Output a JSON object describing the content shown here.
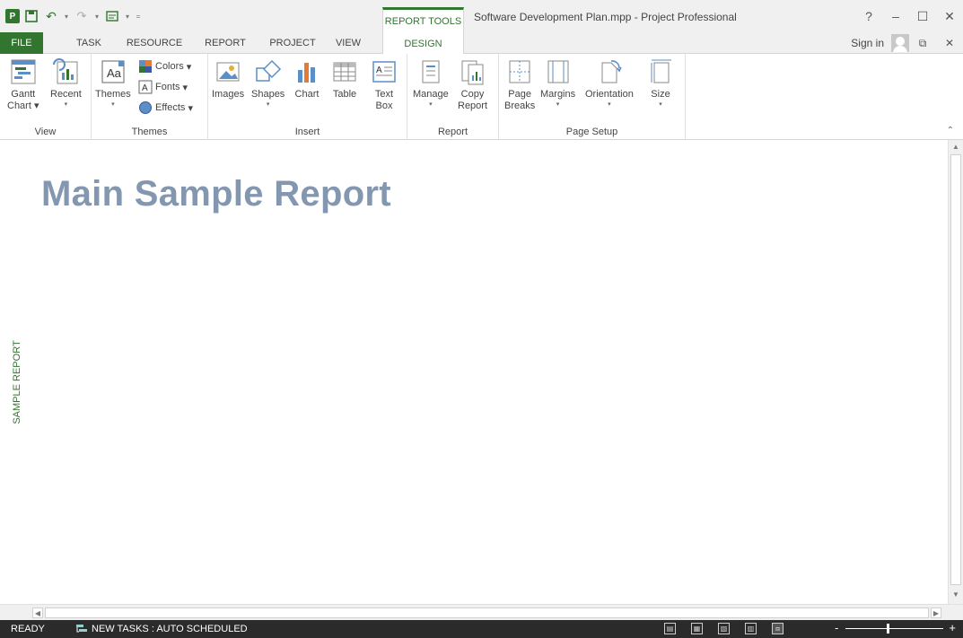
{
  "app": {
    "context_tab": "REPORT TOOLS",
    "title": "Software Development Plan.mpp - Project Professional",
    "help": "?"
  },
  "tabs": [
    {
      "label": "FILE"
    },
    {
      "label": "TASK"
    },
    {
      "label": "RESOURCE"
    },
    {
      "label": "REPORT"
    },
    {
      "label": "PROJECT"
    },
    {
      "label": "VIEW"
    },
    {
      "label": "DESIGN"
    }
  ],
  "account": {
    "signin": "Sign in"
  },
  "ribbon": {
    "view": {
      "label": "View",
      "gantt_l1": "Gantt",
      "gantt_l2": "Chart",
      "recent": "Recent"
    },
    "themes": {
      "label": "Themes",
      "themes": "Themes",
      "colors": "Colors",
      "fonts": "Fonts",
      "effects": "Effects"
    },
    "insert": {
      "label": "Insert",
      "images": "Images",
      "shapes": "Shapes",
      "chart": "Chart",
      "table": "Table",
      "textbox_l1": "Text",
      "textbox_l2": "Box"
    },
    "report": {
      "label": "Report",
      "manage": "Manage",
      "copy_l1": "Copy",
      "copy_l2": "Report"
    },
    "page_setup": {
      "label": "Page Setup",
      "pagebreaks_l1": "Page",
      "pagebreaks_l2": "Breaks",
      "margins": "Margins",
      "orientation": "Orientation",
      "size": "Size"
    }
  },
  "document": {
    "report_title": "Main Sample Report",
    "side_label": "SAMPLE REPORT"
  },
  "status": {
    "ready": "READY",
    "new_tasks": "NEW TASKS : AUTO SCHEDULED"
  },
  "colors": {
    "brand": "#31752f",
    "title_blue": "#8497b0",
    "status_bg": "#2b2b2b"
  }
}
